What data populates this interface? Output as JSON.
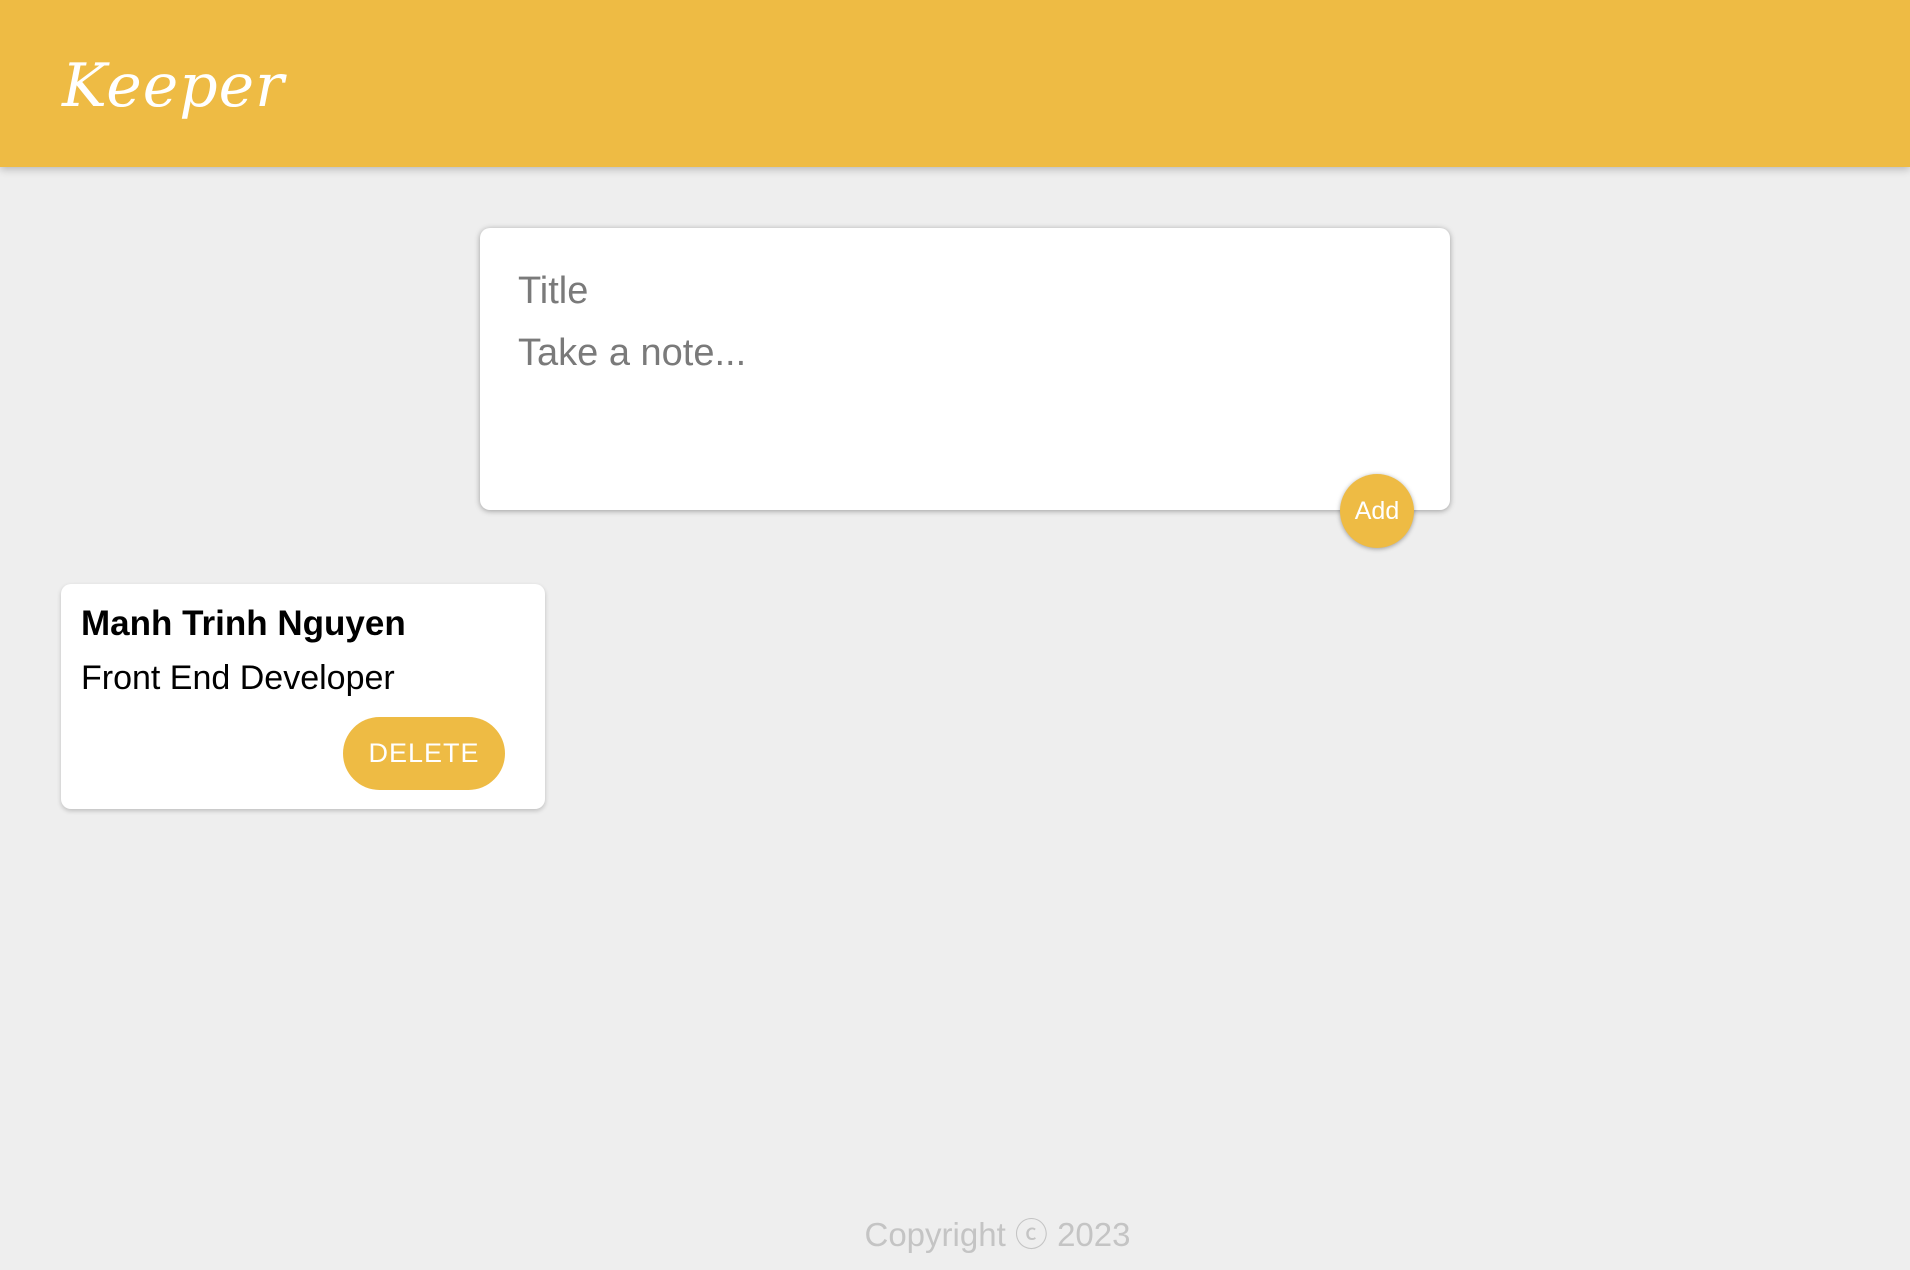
{
  "header": {
    "logo_text": "Keeper"
  },
  "create_area": {
    "title_placeholder": "Title",
    "title_value": "",
    "content_placeholder": "Take a note...",
    "content_value": "",
    "add_label": "Add"
  },
  "notes": [
    {
      "title": "Manh Trinh Nguyen",
      "content": "Front End Developer",
      "delete_label": "DELETE"
    }
  ],
  "footer": {
    "text": "Copyright ⓒ 2023"
  },
  "colors": {
    "accent": "#eebb44",
    "background": "#eeeeee",
    "card": "#ffffff",
    "footer_text": "#c4c4c4"
  }
}
